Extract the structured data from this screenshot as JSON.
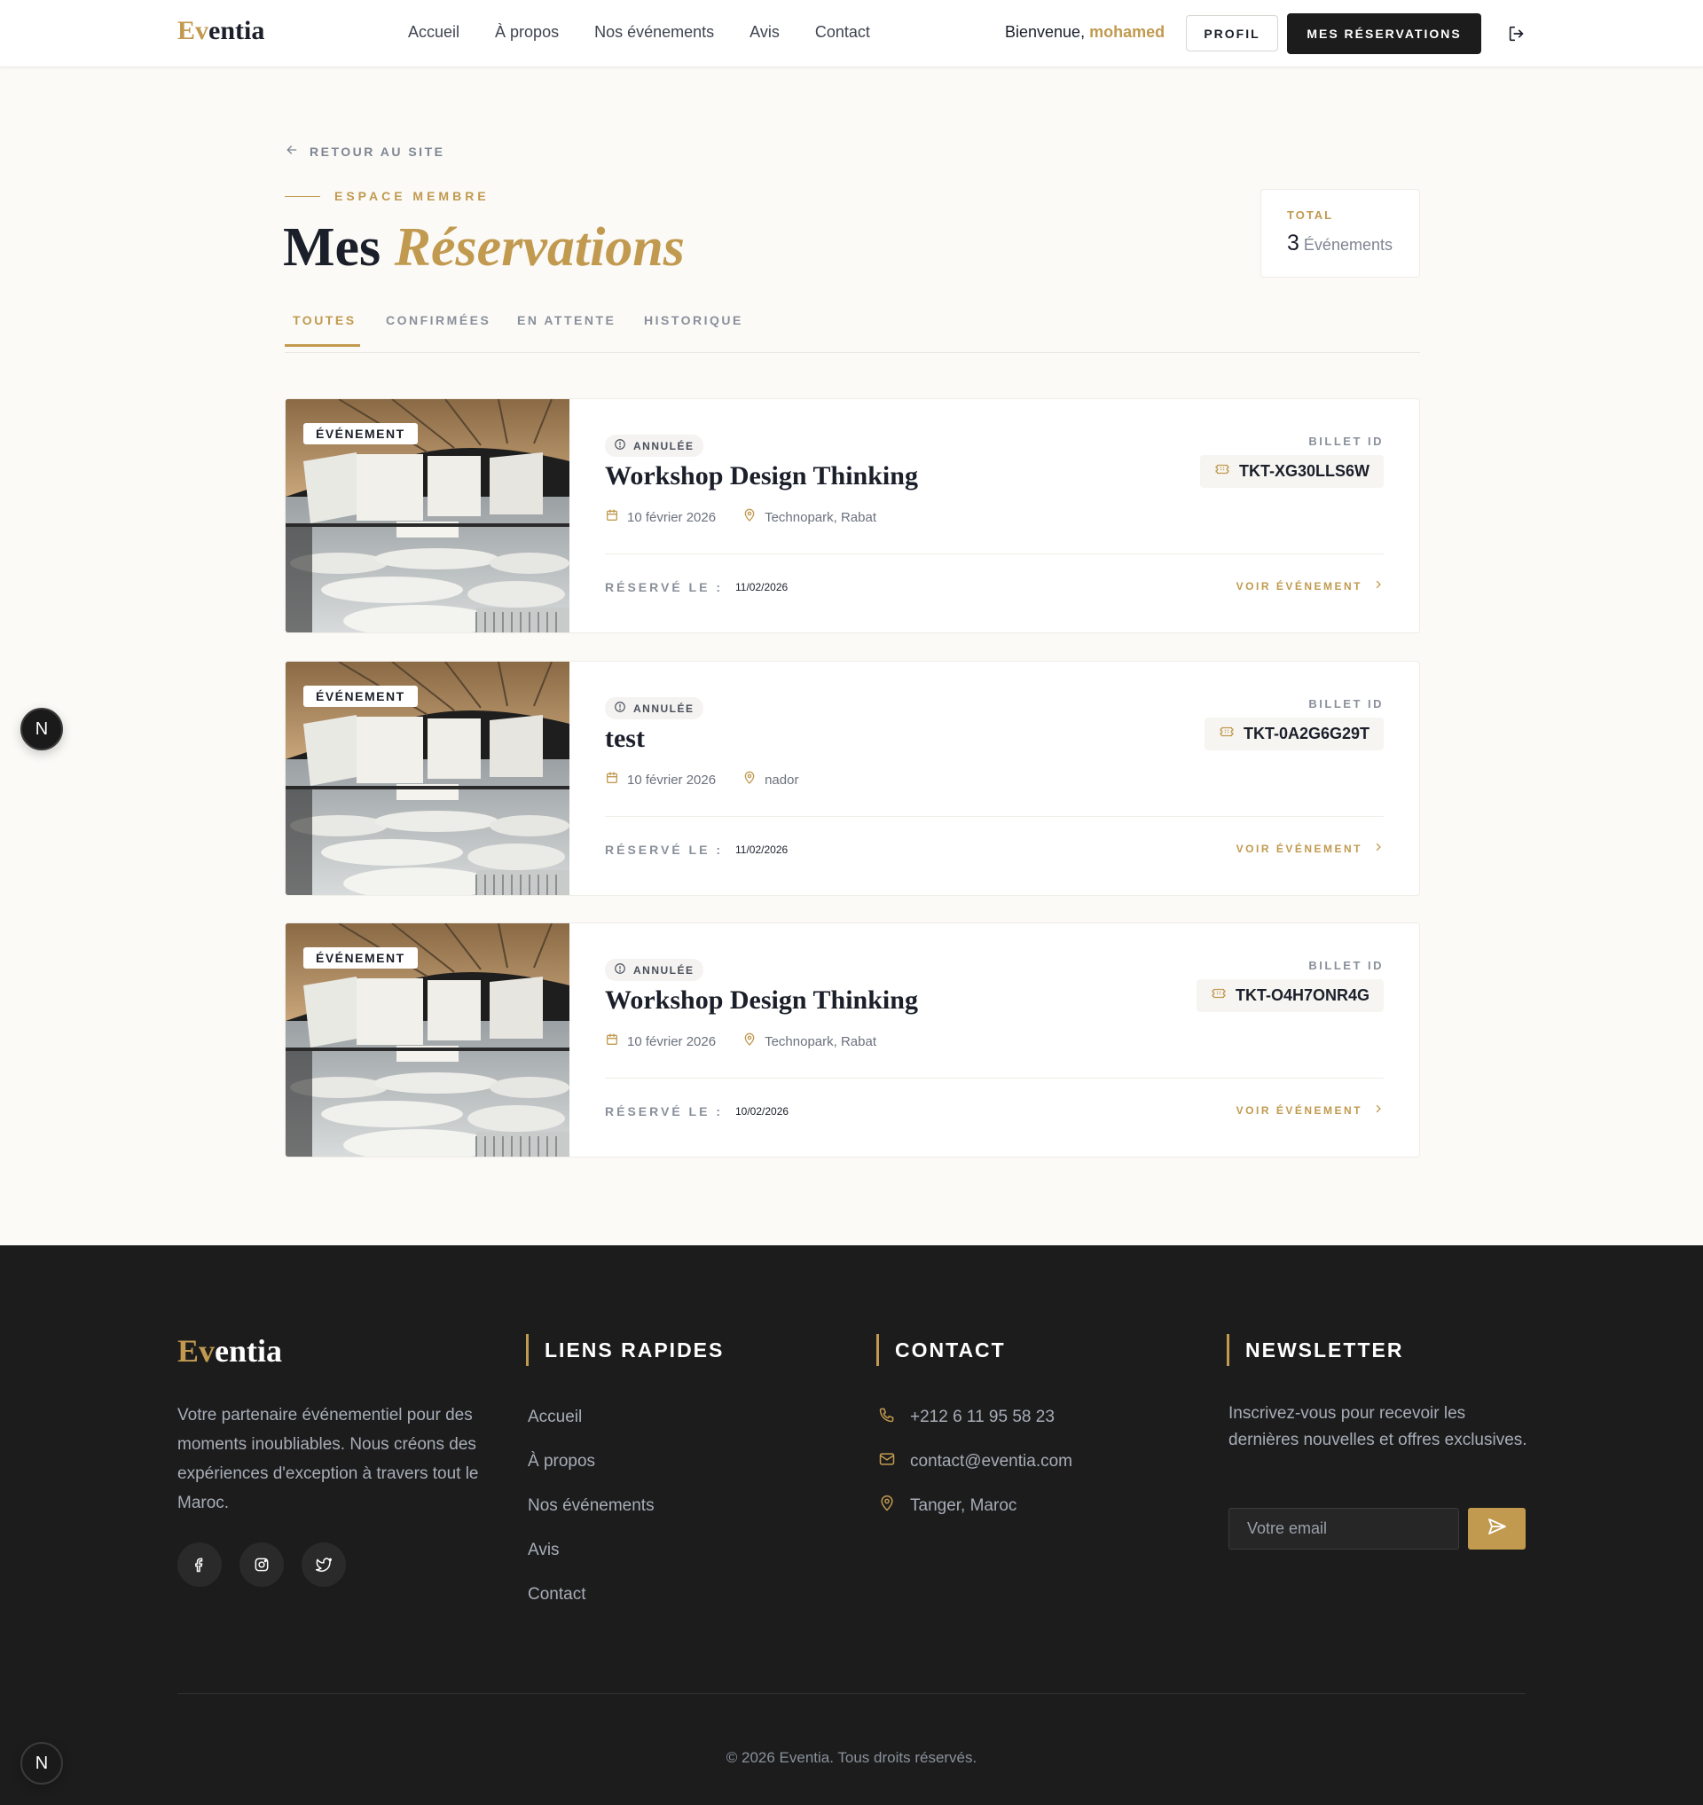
{
  "brand": {
    "name_accent": "Ev",
    "name_rest": "entia"
  },
  "header": {
    "nav": [
      "Accueil",
      "À propos",
      "Nos événements",
      "Avis",
      "Contact"
    ],
    "welcome_prefix": "Bienvenue, ",
    "username": "mohamed",
    "profile_button": "PROFIL",
    "reservations_button": "MES RÉSERVATIONS"
  },
  "page": {
    "back_link": "RETOUR AU SITE",
    "eyebrow": "ESPACE MEMBRE",
    "title_plain": "Mes ",
    "title_accent": "Réservations",
    "total_label": "TOTAL",
    "total_count": "3",
    "total_unit": "Événements",
    "tabs": [
      "TOUTES",
      "CONFIRMÉES",
      "EN ATTENTE",
      "HISTORIQUE"
    ]
  },
  "reservations": [
    {
      "badge": "ÉVÉNEMENT",
      "status": "ANNULÉE",
      "title": "Workshop Design Thinking",
      "date": "10 février 2026",
      "location": "Technopark, Rabat",
      "reserved_label": "RÉSERVÉ LE :",
      "reserved_date": "11/02/2026",
      "ticket_label": "BILLET ID",
      "ticket_id": "TKT-XG30LLS6W",
      "link": "VOIR ÉVÉNEMENT"
    },
    {
      "badge": "ÉVÉNEMENT",
      "status": "ANNULÉE",
      "title": "test",
      "date": "10 février 2026",
      "location": "nador",
      "reserved_label": "RÉSERVÉ LE :",
      "reserved_date": "11/02/2026",
      "ticket_label": "BILLET ID",
      "ticket_id": "TKT-0A2G6G29T",
      "link": "VOIR ÉVÉNEMENT"
    },
    {
      "badge": "ÉVÉNEMENT",
      "status": "ANNULÉE",
      "title": "Workshop Design Thinking",
      "date": "10 février 2026",
      "location": "Technopark, Rabat",
      "reserved_label": "RÉSERVÉ LE :",
      "reserved_date": "10/02/2026",
      "ticket_label": "BILLET ID",
      "ticket_id": "TKT-O4H7ONR4G",
      "link": "VOIR ÉVÉNEMENT"
    }
  ],
  "floating_badge": "N",
  "footer": {
    "about": "Votre partenaire événementiel pour des moments inoubliables. Nous créons des expériences d'exception à travers tout le Maroc.",
    "socials": [
      "facebook-icon",
      "instagram-icon",
      "twitter-icon"
    ],
    "links_heading": "LIENS RAPIDES",
    "links": [
      "Accueil",
      "À propos",
      "Nos événements",
      "Avis",
      "Contact"
    ],
    "contact_heading": "CONTACT",
    "phone": "+212 6 11 95 58 23",
    "email": "contact@eventia.com",
    "address": "Tanger, Maroc",
    "newsletter_heading": "NEWSLETTER",
    "newsletter_text": "Inscrivez-vous pour recevoir les dernières nouvelles et offres exclusives.",
    "email_placeholder": "Votre email",
    "copyright": "© 2026 Eventia. Tous droits réservés."
  },
  "colors": {
    "accent": "#c19a4f",
    "dark": "#1c1c1c",
    "background": "#fbfaf7"
  }
}
